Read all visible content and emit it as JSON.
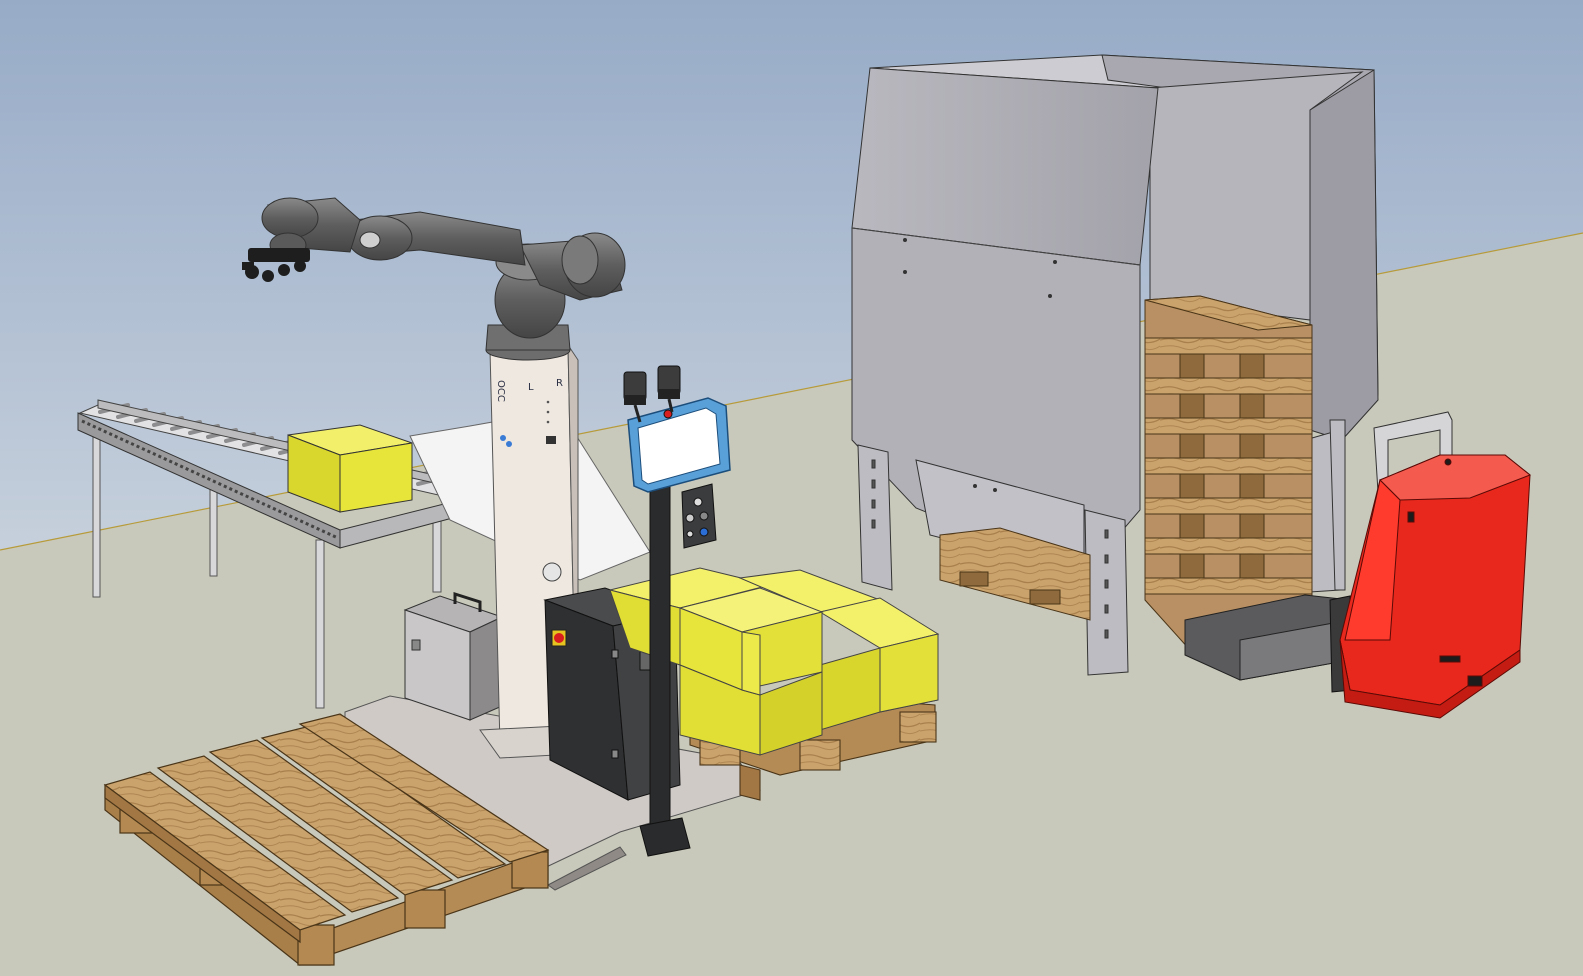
{
  "scene": {
    "colors": {
      "sky_top": "#97abc7",
      "sky_bottom": "#c7d2df",
      "floor": "#c9c9bb",
      "horizon_line": "#b79b3a",
      "pallet_wood": "#c9a26c",
      "pallet_dark": "#8e6a3d",
      "box_yellow": "#e7e53a",
      "frame_grey": "#c8c8cb",
      "robot_grey": "#6a6a6a",
      "column_cream": "#efe8e0",
      "cabinet_dark": "#2e2f31",
      "hopper_grey": "#b2b1b8",
      "agv_red": "#e8281c",
      "pendant_blue": "#5aa0d8"
    },
    "robot": {
      "arm": "collaborative-robot-arm",
      "column_markings": {
        "left": "L",
        "right": "R",
        "brand_vertical": "OCC"
      }
    },
    "teach_pendant": {
      "screen_text": ""
    },
    "stack_lights": {
      "count": 2
    },
    "icons": [
      "emergency-stop-icon",
      "status-light-icon",
      "gripper-icon"
    ]
  }
}
